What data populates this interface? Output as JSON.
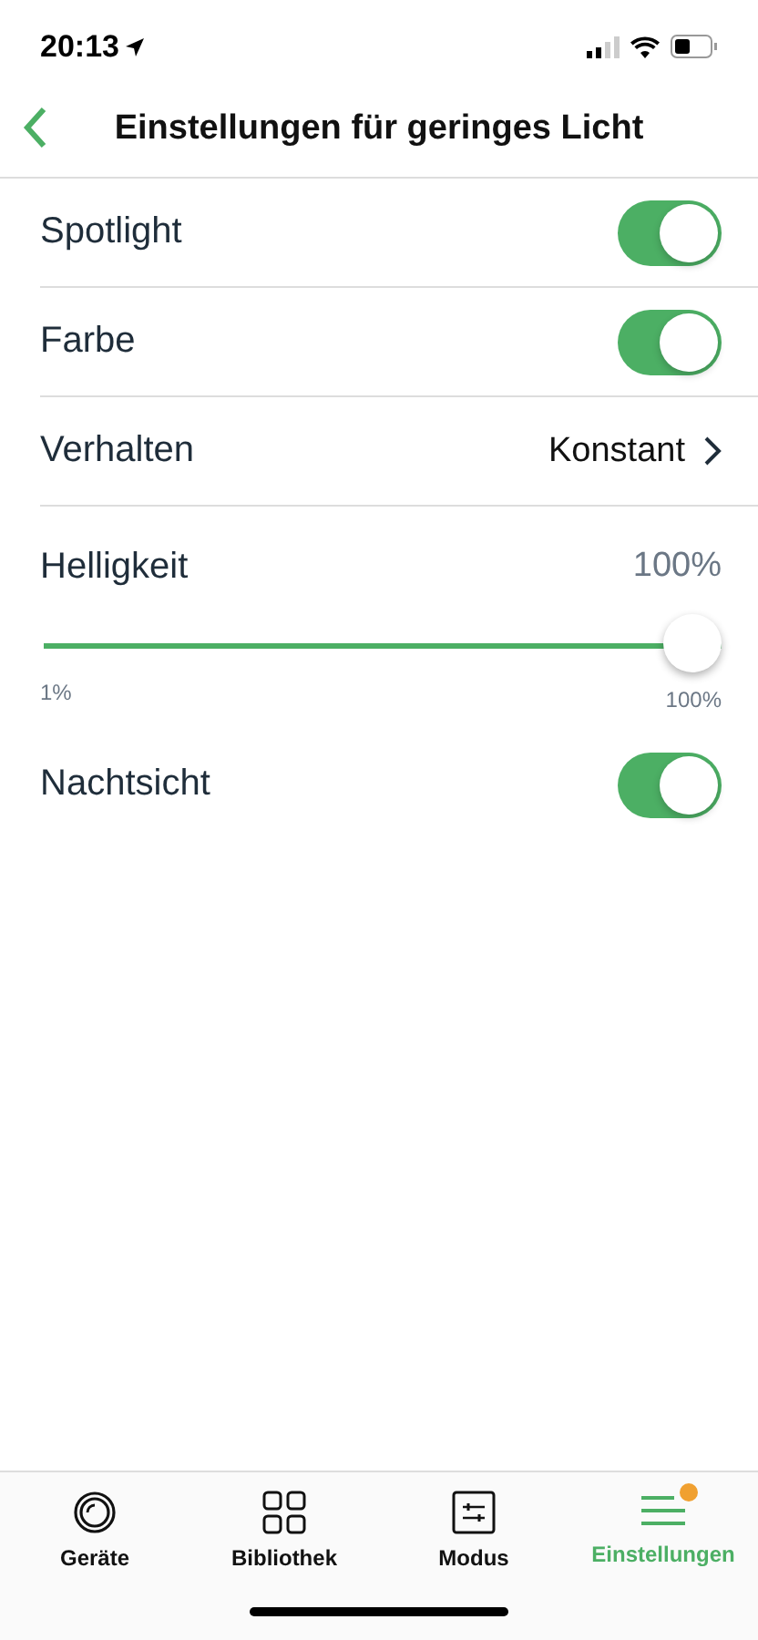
{
  "status_bar": {
    "time": "20:13"
  },
  "nav": {
    "title": "Einstellungen für geringes Licht"
  },
  "settings": [
    {
      "kind": "toggle",
      "label": "Spotlight",
      "on": true
    },
    {
      "kind": "toggle",
      "label": "Farbe",
      "on": true
    },
    {
      "kind": "disclosure",
      "label": "Verhalten",
      "value": "Konstant"
    },
    {
      "kind": "slider",
      "label": "Helligkeit",
      "reading": "100%",
      "level": 1,
      "min_label": "1%",
      "max_label": "100%"
    },
    {
      "kind": "toggle",
      "label": "Nachtsicht",
      "on": true
    }
  ],
  "tab_bar": [
    {
      "label": "Geräte",
      "selected": false,
      "badge": false
    },
    {
      "label": "Bibliothek",
      "selected": false,
      "badge": false
    },
    {
      "label": "Modus",
      "selected": false,
      "badge": false
    },
    {
      "label": "Einstellungen",
      "selected": true,
      "badge": true
    }
  ]
}
